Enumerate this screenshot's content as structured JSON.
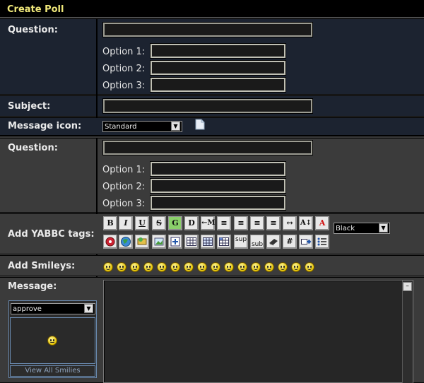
{
  "header": {
    "title": "Create Poll"
  },
  "poll1": {
    "question_label": "Question:",
    "options": [
      "Option 1:",
      "Option 2:",
      "Option 3:"
    ]
  },
  "subject_label": "Subject:",
  "message_icon": {
    "label": "Message icon:",
    "selected": "Standard",
    "icon": "document-icon"
  },
  "poll2": {
    "question_label": "Question:",
    "options": [
      "Option 1:",
      "Option 2:",
      "Option 3:"
    ]
  },
  "yabbc": {
    "label": "Add YABBC tags:",
    "color_selected": "Black",
    "row1": [
      "B",
      "I",
      "U",
      "S",
      "G",
      "D",
      "←M",
      "≡",
      "≡",
      "≡",
      "≡",
      "↔",
      "A↕",
      "A"
    ],
    "row2_icons": [
      "flash-icon",
      "globe-icon",
      "ftp-icon",
      "image-icon",
      "move-icon",
      "table-icon",
      "table-row-icon",
      "table-cell-icon"
    ],
    "row2_text": [
      "sup",
      "sub"
    ],
    "row2_more": [
      "teletype-icon",
      "#",
      "quote-icon",
      "list-icon"
    ]
  },
  "smileys": {
    "label": "Add Smileys:"
  },
  "message": {
    "label": "Message:"
  },
  "smiley_picker": {
    "selected": "approve",
    "view_all": "View All Smilies"
  },
  "colors": {
    "accent_title": "#f0e87a",
    "row_dark": "#1c2330",
    "row_alt": "#3b3b3b"
  }
}
